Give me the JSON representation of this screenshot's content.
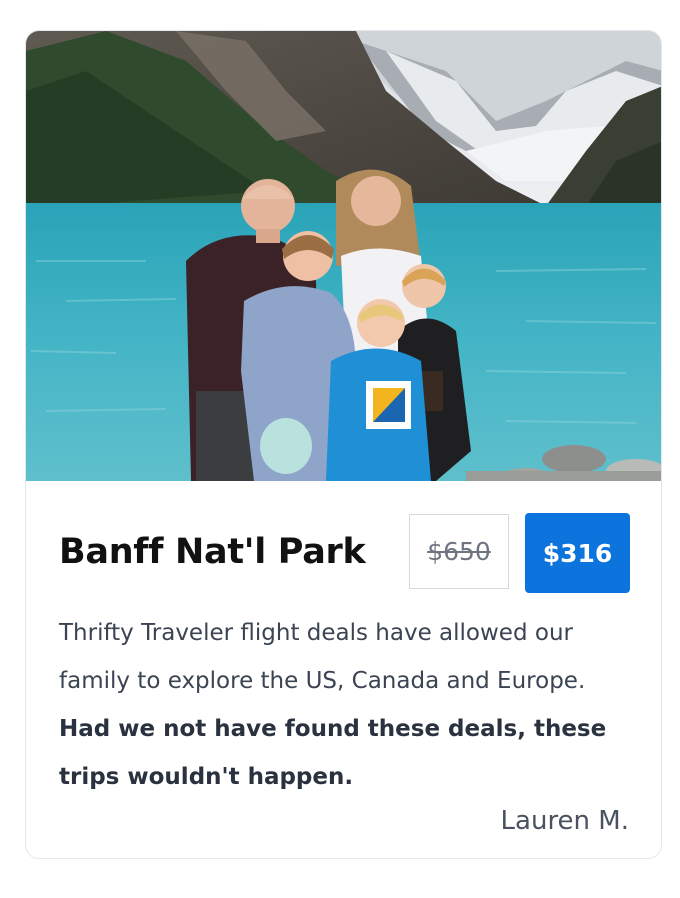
{
  "card": {
    "photo_alt": "Family photo at a turquoise mountain lake",
    "title": "Banff Nat'l Park",
    "old_price": "$650",
    "new_price": "$316",
    "testimonial_regular": "Thrifty Traveler flight deals have allowed our family to explore the US, Canada and Europe. ",
    "testimonial_bold": "Had we not have found these deals, these trips wouldn't happen.",
    "author": "Lauren M."
  },
  "colors": {
    "price_badge": "#0d74de",
    "lake": "#3fb0c4",
    "text_dark": "#111111",
    "text_body": "#3b4452"
  }
}
